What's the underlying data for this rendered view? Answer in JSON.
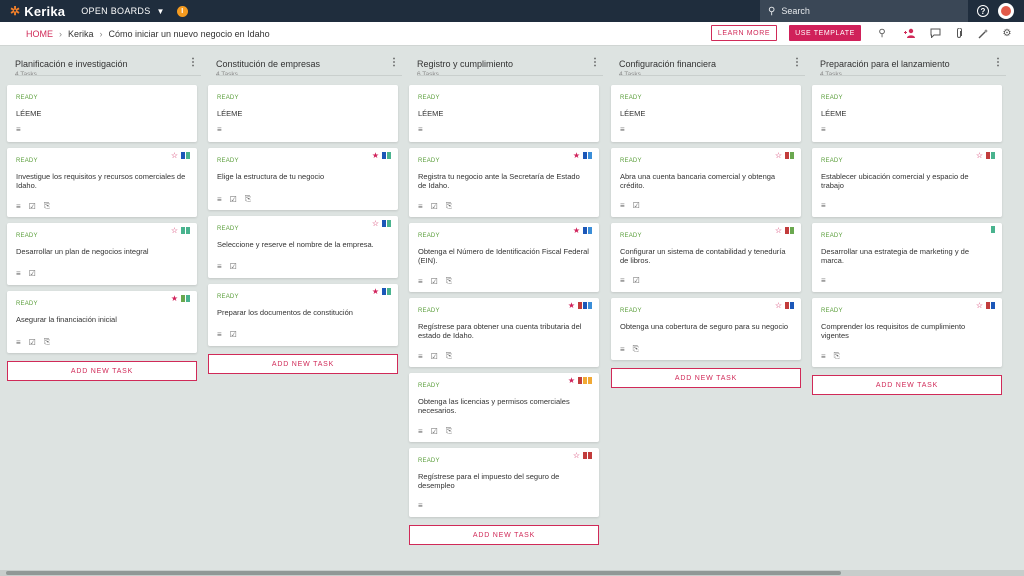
{
  "app": {
    "logo_text": "Kerika",
    "open_boards": "OPEN BOARDS",
    "org_initial": "I"
  },
  "search": {
    "placeholder": "Search"
  },
  "breadcrumb": {
    "home": "HOME",
    "org": "Kerika",
    "board": "Cómo iniciar un nuevo negocio en Idaho"
  },
  "actions": {
    "learn_more": "LEARN MORE",
    "use_template": "USE TEMPLATE"
  },
  "colors": {
    "accent": "#d0215a",
    "ready": "#5a9e3a",
    "topbar": "#1f2d3d",
    "board_bg": "#dde3e1"
  },
  "columns": [
    {
      "title": "Planificación e investigación",
      "count": "4 Tasks",
      "add_label": "ADD NEW TASK",
      "cards": [
        {
          "status": "READY",
          "title": "LÉEME",
          "icons": [
            "desc"
          ],
          "star": "none",
          "flags": []
        },
        {
          "status": "READY",
          "title": "Investigue los requisitos y recursos comerciales de Idaho.",
          "icons": [
            "desc",
            "checklist",
            "attach"
          ],
          "star": "outline",
          "flags": [
            "#1b57b8",
            "#49b38e"
          ]
        },
        {
          "status": "READY",
          "title": "Desarrollar un plan de negocios integral",
          "icons": [
            "desc",
            "checklist"
          ],
          "star": "outline",
          "flags": [
            "#49b38e",
            "#49b38e"
          ]
        },
        {
          "status": "READY",
          "title": "Asegurar la financiación inicial",
          "icons": [
            "desc",
            "checklist",
            "attach"
          ],
          "star": "filled",
          "flags": [
            "#6aa84f",
            "#49b38e"
          ]
        }
      ]
    },
    {
      "title": "Constitución de empresas",
      "count": "4 Tasks",
      "add_label": "ADD NEW TASK",
      "cards": [
        {
          "status": "READY",
          "title": "LÉEME",
          "icons": [
            "desc"
          ],
          "star": "none",
          "flags": []
        },
        {
          "status": "READY",
          "title": "Elige la estructura de tu negocio",
          "icons": [
            "desc",
            "checklist",
            "attach"
          ],
          "star": "filled",
          "flags": [
            "#1b57b8",
            "#49b38e"
          ]
        },
        {
          "status": "READY",
          "title": "Seleccione y reserve el nombre de la empresa.",
          "icons": [
            "desc",
            "checklist"
          ],
          "star": "outline",
          "flags": [
            "#1b57b8",
            "#49b38e"
          ]
        },
        {
          "status": "READY",
          "title": "Preparar los documentos de constitución",
          "icons": [
            "desc",
            "checklist"
          ],
          "star": "filled",
          "flags": [
            "#1b57b8",
            "#49b38e"
          ]
        }
      ]
    },
    {
      "title": "Registro y cumplimiento",
      "count": "6 Tasks",
      "add_label": "ADD NEW TASK",
      "cards": [
        {
          "status": "READY",
          "title": "LÉEME",
          "icons": [
            "desc"
          ],
          "star": "none",
          "flags": []
        },
        {
          "status": "READY",
          "title": "Registra tu negocio ante la Secretaría de Estado de Idaho.",
          "icons": [
            "desc",
            "checklist",
            "attach"
          ],
          "star": "filled",
          "flags": [
            "#1b57b8",
            "#3b8ed8"
          ]
        },
        {
          "status": "READY",
          "title": "Obtenga el Número de Identificación Fiscal Federal (EIN).",
          "icons": [
            "desc",
            "checklist",
            "attach"
          ],
          "star": "filled",
          "flags": [
            "#1b57b8",
            "#3b8ed8"
          ]
        },
        {
          "status": "READY",
          "title": "Regístrese para obtener una cuenta tributaria del estado de Idaho.",
          "icons": [
            "desc",
            "checklist",
            "attach"
          ],
          "star": "filled",
          "flags": [
            "#c23c3c",
            "#1b57b8",
            "#3b8ed8"
          ]
        },
        {
          "status": "READY",
          "title": "Obtenga las licencias y permisos comerciales necesarios.",
          "icons": [
            "desc",
            "checklist",
            "attach"
          ],
          "star": "filled",
          "flags": [
            "#c23c3c",
            "#f1a935",
            "#f1a935"
          ]
        },
        {
          "status": "READY",
          "title": "Regístrese para el impuesto del seguro de desempleo",
          "icons": [
            "desc"
          ],
          "star": "outline",
          "flags": [
            "#c23c3c",
            "#c23c3c"
          ]
        }
      ]
    },
    {
      "title": "Configuración financiera",
      "count": "4 Tasks",
      "add_label": "ADD NEW TASK",
      "cards": [
        {
          "status": "READY",
          "title": "LÉEME",
          "icons": [
            "desc"
          ],
          "star": "none",
          "flags": []
        },
        {
          "status": "READY",
          "title": "Abra una cuenta bancaria comercial y obtenga crédito.",
          "icons": [
            "desc",
            "checklist"
          ],
          "star": "outline",
          "flags": [
            "#c23c3c",
            "#6aa84f"
          ]
        },
        {
          "status": "READY",
          "title": "Configurar un sistema de contabilidad y teneduría de libros.",
          "icons": [
            "desc",
            "checklist"
          ],
          "star": "outline",
          "flags": [
            "#c23c3c",
            "#6aa84f"
          ]
        },
        {
          "status": "READY",
          "title": "Obtenga una cobertura de seguro para su negocio",
          "icons": [
            "desc",
            "attach"
          ],
          "star": "outline",
          "flags": [
            "#c23c3c",
            "#1b57b8"
          ]
        }
      ]
    },
    {
      "title": "Preparación para el lanzamiento",
      "count": "4 Tasks",
      "add_label": "ADD NEW TASK",
      "cards": [
        {
          "status": "READY",
          "title": "LÉEME",
          "icons": [
            "desc"
          ],
          "star": "none",
          "flags": []
        },
        {
          "status": "READY",
          "title": "Establecer ubicación comercial y espacio de trabajo",
          "icons": [
            "desc"
          ],
          "star": "outline",
          "flags": [
            "#c23c3c",
            "#49b38e"
          ]
        },
        {
          "status": "READY",
          "title": "Desarrollar una estrategia de marketing y de marca.",
          "icons": [
            "desc"
          ],
          "star": "none",
          "flags": [
            "#49b38e"
          ]
        },
        {
          "status": "READY",
          "title": "Comprender los requisitos de cumplimiento vigentes",
          "icons": [
            "desc",
            "attach"
          ],
          "star": "outline",
          "flags": [
            "#c23c3c",
            "#1b57b8"
          ]
        }
      ]
    }
  ]
}
